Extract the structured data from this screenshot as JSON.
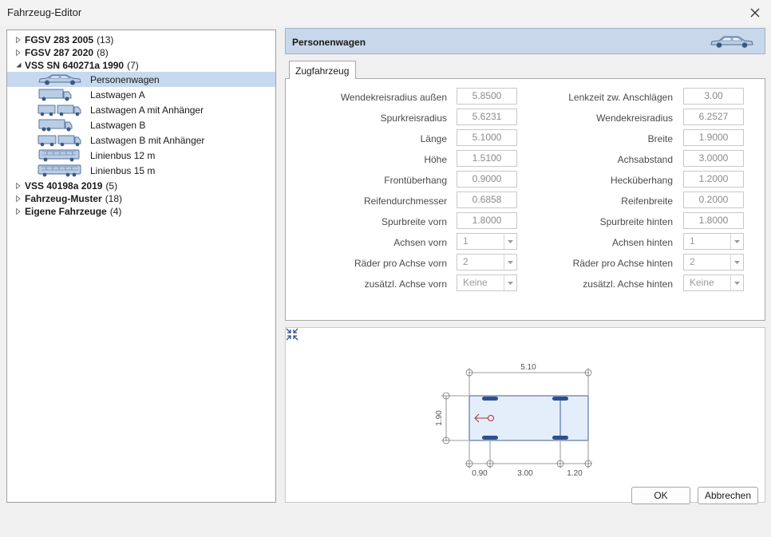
{
  "window": {
    "title": "Fahrzeug-Editor"
  },
  "tree": {
    "groups_top": [
      {
        "label": "FGSV 283 2005",
        "count": "(13)"
      },
      {
        "label": "FGSV 287 2020",
        "count": "(8)"
      },
      {
        "label": "VSS SN 640271a 1990",
        "count": "(7)"
      }
    ],
    "vehicles": [
      {
        "label": "Personenwagen",
        "icon": "car-icon"
      },
      {
        "label": "Lastwagen A",
        "icon": "truck-icon"
      },
      {
        "label": "Lastwagen A mit Anhänger",
        "icon": "truck-trailer-icon"
      },
      {
        "label": "Lastwagen B",
        "icon": "truck-icon"
      },
      {
        "label": "Lastwagen B mit Anhänger",
        "icon": "truck-trailer-icon"
      },
      {
        "label": "Linienbus 12 m",
        "icon": "bus-icon"
      },
      {
        "label": "Linienbus 15 m",
        "icon": "bus-icon"
      }
    ],
    "groups_bottom": [
      {
        "label": "VSS 40198a 2019",
        "count": "(5)"
      },
      {
        "label": "Fahrzeug-Muster",
        "count": "(18)"
      },
      {
        "label": "Eigene Fahrzeuge",
        "count": "(4)"
      }
    ]
  },
  "header": {
    "title": "Personenwagen",
    "icon": "car-icon"
  },
  "tab": {
    "label": "Zugfahrzeug"
  },
  "fields_left": [
    {
      "label": "Wendekreisradius außen",
      "value": "5.8500"
    },
    {
      "label": "Spurkreisradius",
      "value": "5.6231"
    },
    {
      "label": "Länge",
      "value": "5.1000"
    },
    {
      "label": "Höhe",
      "value": "1.5100"
    },
    {
      "label": "Frontüberhang",
      "value": "0.9000"
    },
    {
      "label": "Reifendurchmesser",
      "value": "0.6858"
    },
    {
      "label": "Spurbreite vorn",
      "value": "1.8000"
    }
  ],
  "fields_right": [
    {
      "label": "Lenkzeit zw. Anschlägen",
      "value": "3.00"
    },
    {
      "label": "Wendekreisradius",
      "value": "6.2527"
    },
    {
      "label": "Breite",
      "value": "1.9000"
    },
    {
      "label": "Achsabstand",
      "value": "3.0000"
    },
    {
      "label": "Hecküberhang",
      "value": "1.2000"
    },
    {
      "label": "Reifenbreite",
      "value": "0.2000"
    },
    {
      "label": "Spurbreite hinten",
      "value": "1.8000"
    }
  ],
  "selects_left": [
    {
      "label": "Achsen vorn",
      "value": "1"
    },
    {
      "label": "Räder pro Achse vorn",
      "value": "2"
    },
    {
      "label": "zusätzl. Achse vorn",
      "value": "Keine"
    }
  ],
  "selects_right": [
    {
      "label": "Achsen hinten",
      "value": "1"
    },
    {
      "label": "Räder pro Achse hinten",
      "value": "2"
    },
    {
      "label": "zusätzl. Achse hinten",
      "value": "Keine"
    }
  ],
  "preview": {
    "length": "5.10",
    "width": "1.90",
    "front_overhang": "0.90",
    "wheelbase": "3.00",
    "rear_overhang": "1.20"
  },
  "buttons": {
    "ok": "OK",
    "cancel": "Abbrechen"
  },
  "colors": {
    "header_bg": "#c8d8ea",
    "selection_bg": "#c7d9ef",
    "vehicle_body": "#e4eefa",
    "wheel": "#2f4f8f",
    "direction_arrow": "#b03030"
  }
}
